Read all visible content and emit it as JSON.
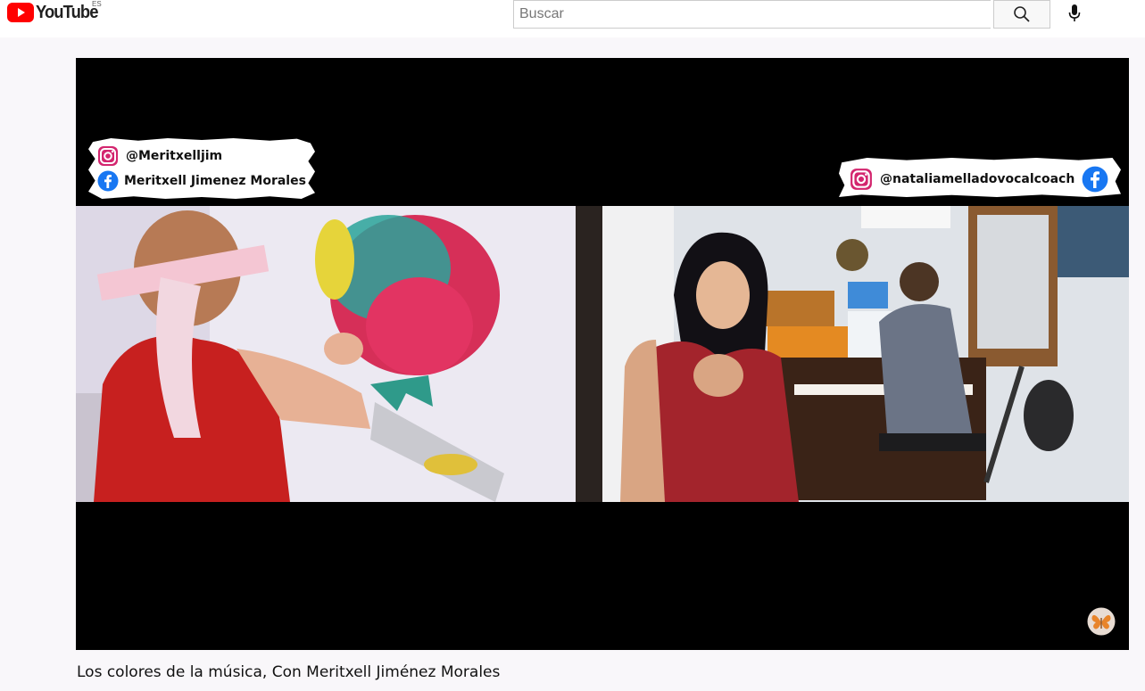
{
  "header": {
    "logo_text": "YouTube",
    "region": "ES",
    "search_placeholder": "Buscar",
    "brand_color": "#ff0000"
  },
  "video": {
    "overlay_left": {
      "instagram_handle": "@Meritxelljim",
      "facebook_name": "Meritxell Jimenez Morales"
    },
    "overlay_right": {
      "instagram_handle": "@nataliamelladovocalcoach"
    }
  },
  "title": "Los colores de la música, Con Meritxell Jiménez Morales"
}
